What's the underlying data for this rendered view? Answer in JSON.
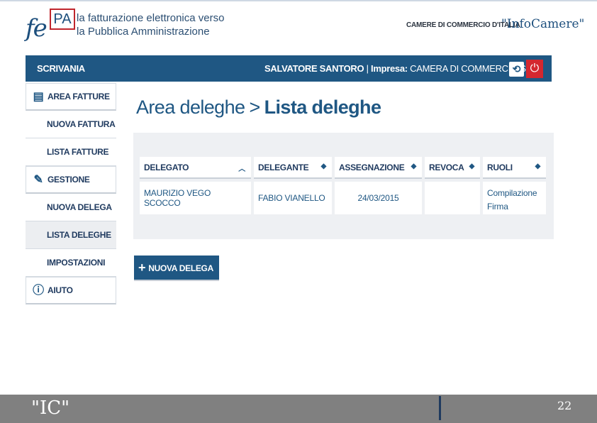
{
  "header": {
    "logo_fe": "fe",
    "logo_pa": "PA",
    "tagline_line1": "la fatturazione elettronica verso",
    "tagline_line2": "la Pubblica Amministrazione",
    "camere": "CAMERE DI COMMERCIO D'ITALIA",
    "infocamere": "\"InfoCamere\""
  },
  "topbar": {
    "scrivania": "SCRIVANIA",
    "user_name": "SALVATORE SANTORO",
    "user_sep": " | ",
    "impresa_label": "Impresa:",
    "impresa_value": " CAMERA DI COMMERCIO SRL"
  },
  "sidebar": {
    "area_fatture": "AREA FATTURE",
    "nuova_fattura": "NUOVA FATTURA",
    "lista_fatture": "LISTA FATTURE",
    "gestione": "GESTIONE",
    "nuova_delega": "NUOVA DELEGA",
    "lista_deleghe": "LISTA DELEGHE",
    "impostazioni": "IMPOSTAZIONI",
    "aiuto": "AIUTO"
  },
  "main": {
    "breadcrumb": "Area deleghe",
    "separator": ">",
    "title": "Lista deleghe",
    "columns": [
      "DELEGATO",
      "DELEGANTE",
      "ASSEGNAZIONE",
      "REVOCA",
      "RUOLI"
    ],
    "row": {
      "delegato": "MAURIZIO VEGO SCOCCO",
      "delegante": "FABIO VIANELLO",
      "assegnazione": "24/03/2015",
      "revoca": "",
      "ruolo1": "Compilazione",
      "ruolo2": "Firma"
    },
    "new_button": "NUOVA DELEGA"
  },
  "footer": {
    "ic": "\"IC\"",
    "page_number": "22"
  },
  "colors": {
    "brand_blue": "#1f5783",
    "logout_red": "#d4272f",
    "panel_bg": "#eef0f3",
    "footer_gray": "#808080"
  }
}
